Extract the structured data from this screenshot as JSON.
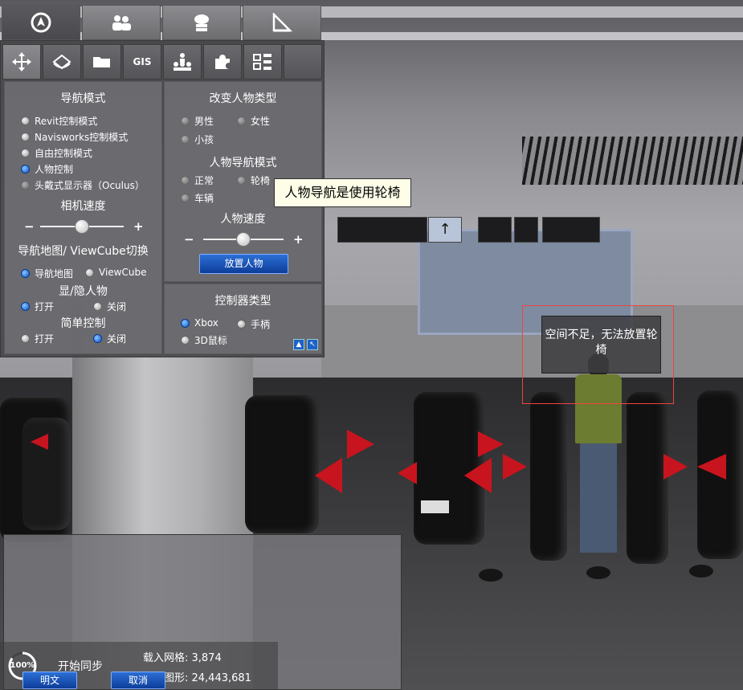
{
  "top_tabs": [
    {
      "icon": "compass-icon",
      "active": true
    },
    {
      "icon": "people-icon",
      "active": false
    },
    {
      "icon": "cloud-server-icon",
      "active": false
    },
    {
      "icon": "measure-icon",
      "active": false
    }
  ],
  "sub_tabs": {
    "move_icon": "move-icon",
    "walk_icon": "walk-icon",
    "folder_icon": "folder-icon",
    "gis_label": "GIS",
    "hierarchy_icon": "hierarchy-icon",
    "plugin_icon": "plugin-icon",
    "tree_icon": "tree-icon"
  },
  "nav_mode": {
    "title": "导航模式",
    "options": [
      {
        "label": "Revit控制模式",
        "selected": false
      },
      {
        "label": "Navisworks控制模式",
        "selected": false
      },
      {
        "label": "自由控制模式",
        "selected": false
      },
      {
        "label": "人物控制",
        "selected": true
      },
      {
        "label": "头戴式显示器（Oculus）",
        "selected": false
      }
    ]
  },
  "camera_speed": {
    "title": "相机速度",
    "minus": "−",
    "plus": "+",
    "value": 0.5
  },
  "map_switch": {
    "title": "导航地图/ ViewCube切换",
    "opt1": "导航地图",
    "opt2": "ViewCube"
  },
  "show_person": {
    "title": "显/隐人物",
    "on": "打开",
    "off": "关闭"
  },
  "simple_control": {
    "title": "简单控制",
    "on": "打开",
    "off": "关闭"
  },
  "person_type": {
    "title": "改变人物类型",
    "male": "男性",
    "female": "女性",
    "child": "小孩"
  },
  "person_nav": {
    "title": "人物导航模式",
    "normal": "正常",
    "wheelchair": "轮椅",
    "vehicle": "车辆"
  },
  "person_speed": {
    "title": "人物速度",
    "minus": "−",
    "plus": "+",
    "value": 0.5
  },
  "place_person_button": "放置人物",
  "controller": {
    "title": "控制器类型",
    "xbox": "Xbox",
    "handle": "手柄",
    "mouse": "3D鼠标"
  },
  "tooltip": "人物导航是使用轮椅",
  "warning": "空间不足，无法放置轮椅",
  "stats": {
    "mesh": "载入网格: 3,874",
    "shapes": "载入图形: 24,443,681"
  },
  "sync_label": "开始同步",
  "progress_label": "100%",
  "progress_value": 1.0,
  "bottom_btn1": "明文",
  "bottom_btn2": "取消",
  "colors": {
    "accent": "#0d57c8",
    "panel": "#5a5a5e",
    "warning": "#e44444"
  }
}
